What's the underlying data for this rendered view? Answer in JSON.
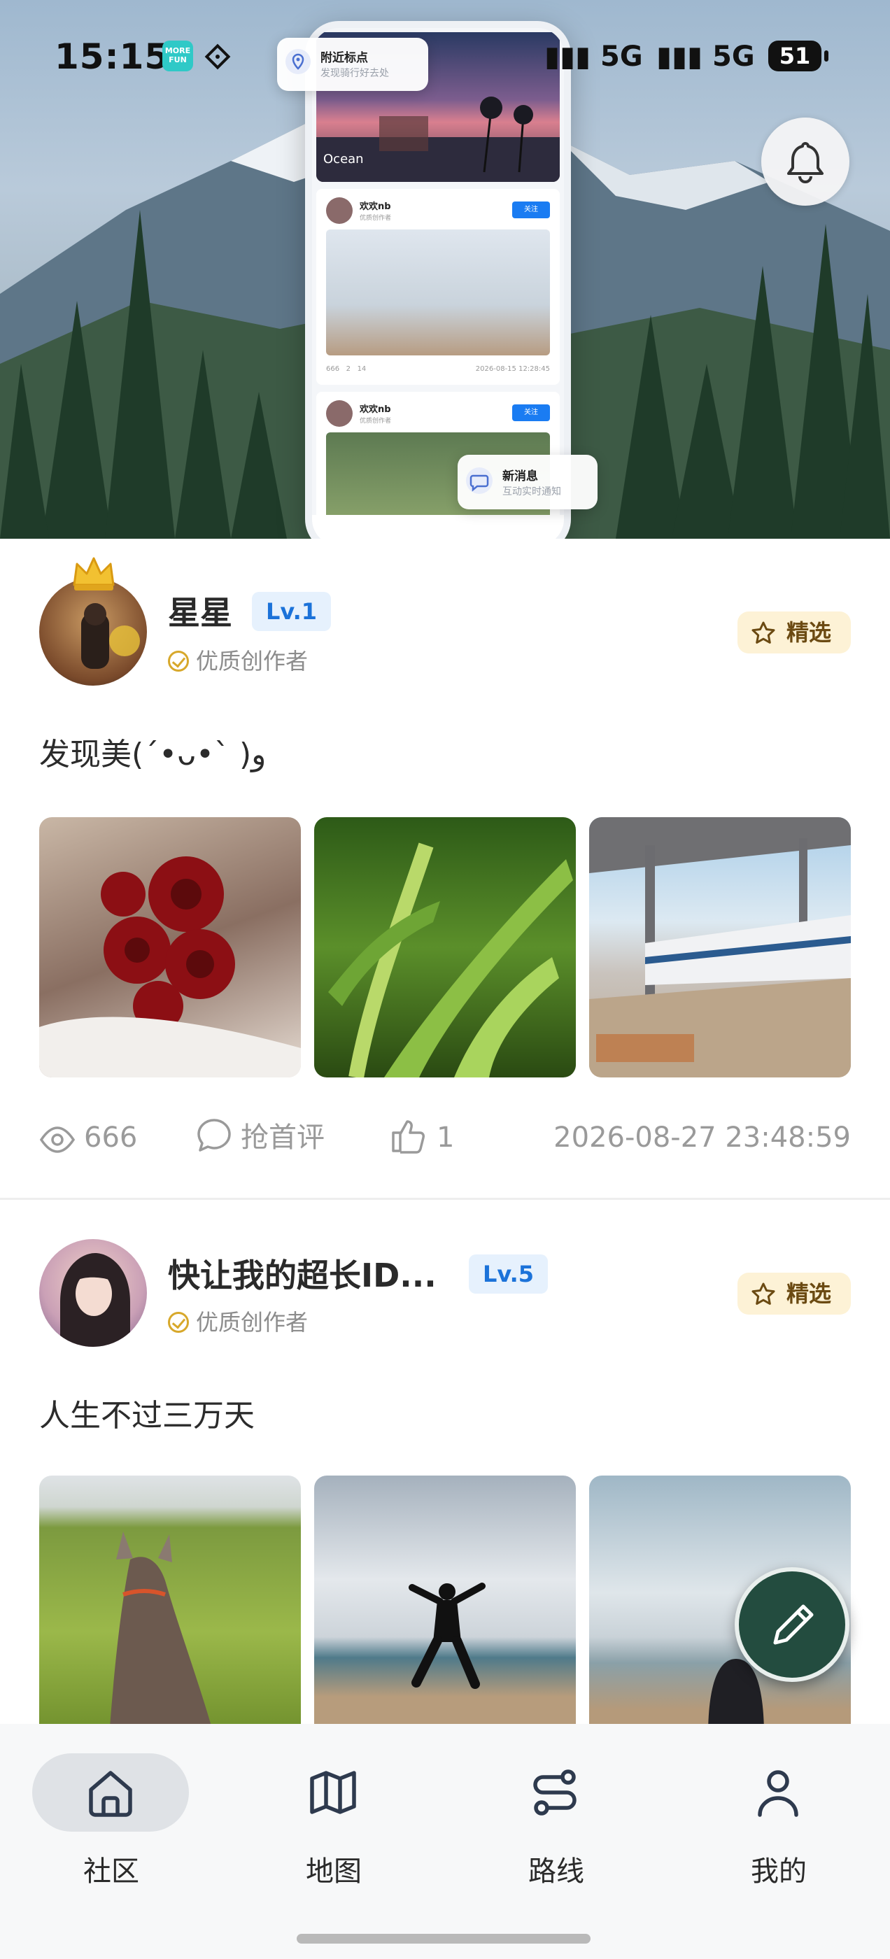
{
  "status_bar": {
    "time": "15:15",
    "app_badge": "MORE FUN",
    "signal_1": "5G",
    "signal_2": "5G",
    "battery": "51"
  },
  "hero_preview": {
    "banner_caption": "Ocean",
    "nearby_popup": {
      "title": "附近标点",
      "subtitle": "发现骑行好去处"
    },
    "message_popup": {
      "title": "新消息",
      "subtitle": "互动实时通知"
    },
    "mini_posts": [
      {
        "name": "欢欢nb",
        "role": "优质创作者",
        "follow": "关注",
        "views": "666",
        "comments": "2",
        "likes": "14",
        "time": "2026-08-15 12:28:45"
      },
      {
        "name": "欢欢nb",
        "role": "优质创作者",
        "follow": "关注"
      }
    ]
  },
  "posts": [
    {
      "author": "星星",
      "level": "Lv.1",
      "role": "优质创作者",
      "badge": "精选",
      "content": "发现美(ˊ•ᴗ•ˋ )و",
      "views": "666",
      "comment_label": "抢首评",
      "likes": "1",
      "time": "2026-08-27 23:48:59"
    },
    {
      "author": "快让我的超长ID...",
      "level": "Lv.5",
      "role": "优质创作者",
      "badge": "精选",
      "content": "人生不过三万天"
    }
  ],
  "tabs": [
    {
      "label": "社区",
      "icon": "home-icon",
      "active": true
    },
    {
      "label": "地图",
      "icon": "map-icon",
      "active": false
    },
    {
      "label": "路线",
      "icon": "route-icon",
      "active": false
    },
    {
      "label": "我的",
      "icon": "user-icon",
      "active": false
    }
  ],
  "colors": {
    "accent_blue": "#1b72d9",
    "badge_gold": "#fdf2d6",
    "fab_green": "#234c3f"
  }
}
